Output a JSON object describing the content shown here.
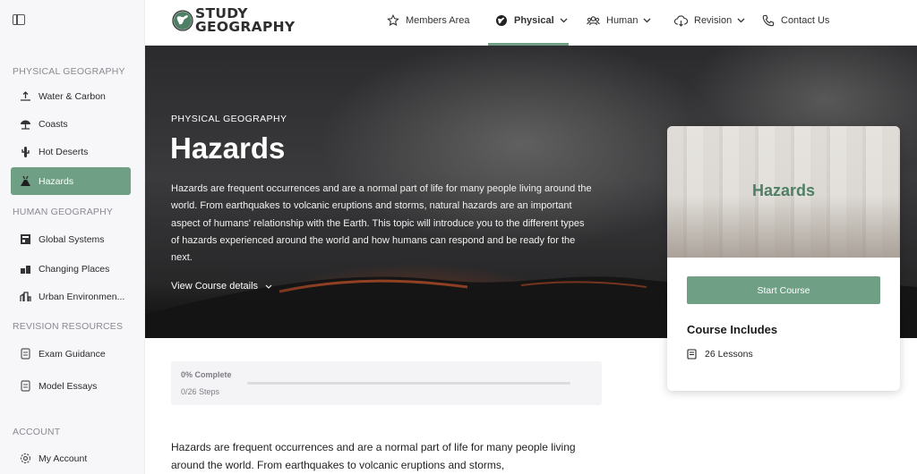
{
  "sidebar": {
    "sections": [
      {
        "label": "PHYSICAL GEOGRAPHY"
      },
      {
        "label": "HUMAN GEOGRAPHY"
      },
      {
        "label": "REVISION RESOURCES"
      },
      {
        "label": "ACCOUNT"
      }
    ],
    "items": [
      {
        "label": "Water & Carbon",
        "icon": "water-cycle-icon"
      },
      {
        "label": "Coasts",
        "icon": "beach-umbrella-icon"
      },
      {
        "label": "Hot Deserts",
        "icon": "cactus-icon"
      },
      {
        "label": "Hazards",
        "icon": "volcano-icon",
        "active": true
      },
      {
        "label": "Global Systems",
        "icon": "trade-boxes-icon"
      },
      {
        "label": "Changing Places",
        "icon": "map-pin-icon"
      },
      {
        "label": "Urban Environmen...",
        "icon": "city-icon"
      },
      {
        "label": "Exam Guidance",
        "icon": "document-icon"
      },
      {
        "label": "Model Essays",
        "icon": "document-icon"
      },
      {
        "label": "My Account",
        "icon": "gear-icon"
      }
    ]
  },
  "nav": {
    "logo_line1": "STUDY",
    "logo_line2": "GEOGRAPHY",
    "items": [
      {
        "label": "Members Area"
      },
      {
        "label": "Physical"
      },
      {
        "label": "Human"
      },
      {
        "label": "Revision"
      },
      {
        "label": "Contact Us"
      }
    ]
  },
  "hero": {
    "eyebrow": "PHYSICAL GEOGRAPHY",
    "title": "Hazards",
    "description": "Hazards are frequent occurrences and are a normal part of life for many people living around the world. From earthquakes to volcanic eruptions and storms, natural hazards are an important aspect of humans' relationship with the Earth. This topic will introduce you to the different types of hazards experienced around the world and how humans can respond and be ready for the next.",
    "details_label": "View Course details"
  },
  "card": {
    "image_title": "Hazards",
    "start_label": "Start Course",
    "includes_title": "Course Includes",
    "lessons_label": "26 Lessons"
  },
  "progress": {
    "complete_label": "0% Complete",
    "steps_label": "0/26 Steps",
    "fraction": 0
  },
  "body": {
    "intro": "Hazards are frequent occurrences and are a normal part of life for many people living around the world. From earthquakes to volcanic eruptions and storms,"
  },
  "colors": {
    "accent": "#6fa085",
    "logo_green": "#4f7f64"
  }
}
